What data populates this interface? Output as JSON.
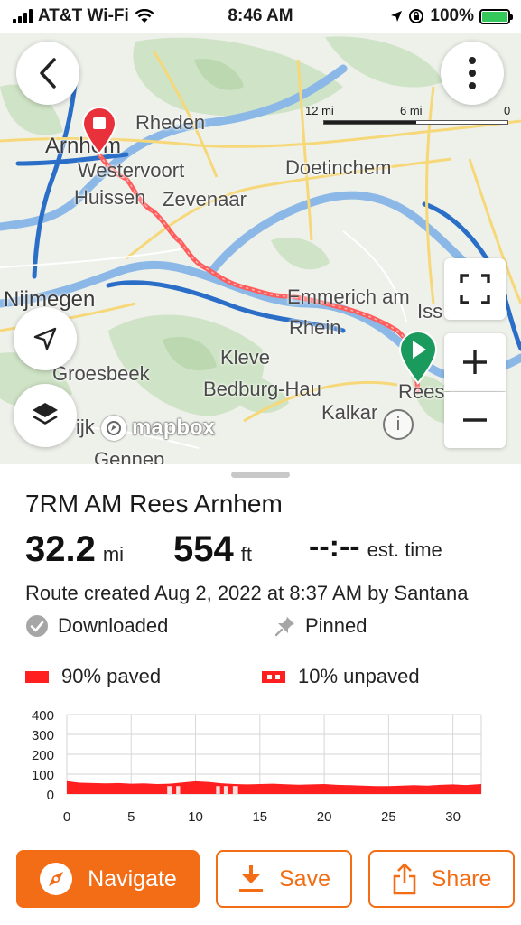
{
  "status_bar": {
    "carrier": "AT&T Wi-Fi",
    "time": "8:46 AM",
    "battery_percent": "100%",
    "battery_level": 1.0,
    "battery_color": "#34c759"
  },
  "map": {
    "scale_labels": [
      "12 mi",
      "6 mi",
      "0"
    ],
    "place_labels": {
      "rheden": "Rheden",
      "arnhem": "Arnhem",
      "westervoort": "Westervoort",
      "huissen": "Huissen",
      "zevenaar": "Zevenaar",
      "doetinchem": "Doetinchem",
      "nijmegen": "Nijmegen",
      "emmerich": "Emmerich am",
      "rhein": "Rhein",
      "kleve": "Kleve",
      "groesbeek": "Groesbeek",
      "bedburg_hau": "Bedburg-Hau",
      "kalkar": "Kalkar",
      "rees": "Rees",
      "gennep": "Gennep",
      "ijk": "ijk",
      "iss": "Iss"
    },
    "attribution": "mapbox",
    "info_glyph": "i",
    "icons": {
      "back": "chevron-left-icon",
      "more": "more-vertical-icon",
      "locate": "location-arrow-icon",
      "layers": "layers-icon",
      "fullscreen": "fullscreen-icon",
      "zoom_in": "plus-icon",
      "zoom_out": "minus-icon"
    },
    "colors": {
      "route": "#ff5c5c",
      "start_pin": "#1a9a5c",
      "end_pin": "#e8313a"
    }
  },
  "route": {
    "name": "7RM AM Rees Arnhem",
    "distance_value": "32.2",
    "distance_unit": "mi",
    "elevation_value": "554",
    "elevation_unit": "ft",
    "time_value": "--:--",
    "time_label": "est. time",
    "created": "Route created Aug 2, 2022 at 8:37 AM by Santana",
    "downloaded_label": "Downloaded",
    "pinned_label": "Pinned",
    "paved_label": "90% paved",
    "unpaved_label": "10% unpaved"
  },
  "chart_data": {
    "type": "area",
    "y_ticks": [
      "400",
      "300",
      "200",
      "100",
      "0"
    ],
    "x_ticks": [
      "0",
      "5",
      "10",
      "15",
      "20",
      "25",
      "30"
    ],
    "ylim": [
      0,
      400
    ],
    "xlim": [
      0,
      32.2
    ],
    "grid": true,
    "series": [
      {
        "x": [
          0,
          1,
          2,
          3,
          4,
          5,
          6,
          7,
          8,
          9,
          10,
          11,
          12,
          13,
          14,
          15,
          16,
          17,
          18,
          19,
          20,
          21,
          22,
          23,
          24,
          25,
          26,
          27,
          28,
          29,
          30,
          31,
          32.2
        ],
        "y": [
          65,
          57,
          55,
          53,
          55,
          52,
          53,
          50,
          52,
          58,
          64,
          61,
          54,
          50,
          48,
          50,
          52,
          49,
          47,
          48,
          50,
          46,
          44,
          42,
          40,
          40,
          42,
          44,
          42,
          46,
          48,
          45,
          50
        ]
      }
    ],
    "unpaved_segments": [
      [
        7.8,
        8.2
      ],
      [
        8.5,
        8.8
      ],
      [
        11.6,
        11.9
      ],
      [
        12.2,
        12.5
      ],
      [
        12.9,
        13.3
      ]
    ],
    "fill_color": "#ff1f1f"
  },
  "actions": {
    "navigate_label": "Navigate",
    "save_label": "Save",
    "share_label": "Share",
    "accent_color": "#f36d16"
  }
}
